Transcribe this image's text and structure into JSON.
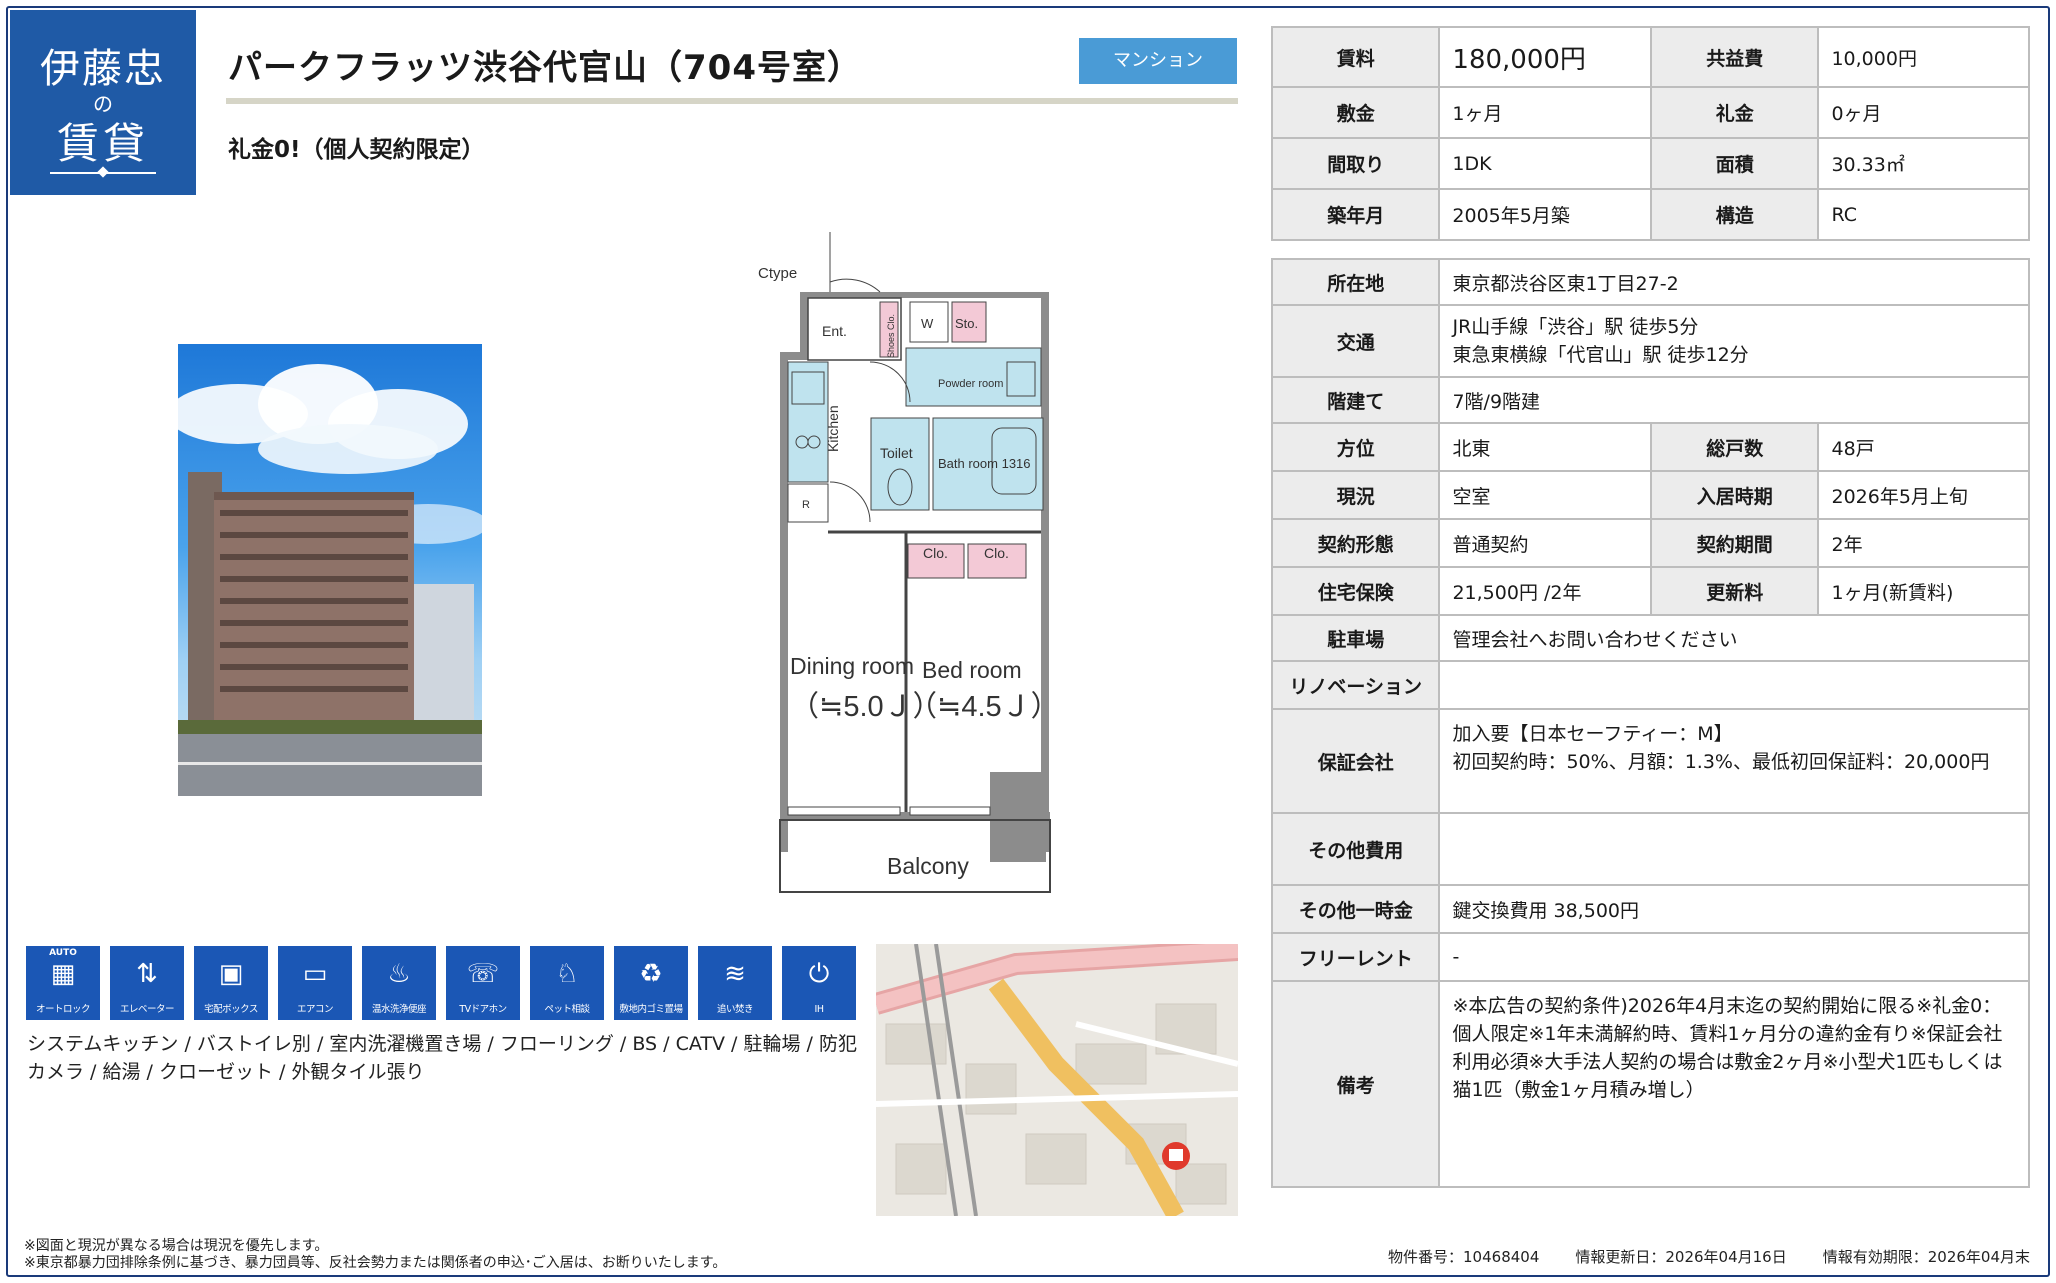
{
  "logo": {
    "line1": "伊藤忠",
    "line2": "の",
    "line3": "賃貸"
  },
  "title": "パークフラッツ渋谷代官山（704号室）",
  "badge": "マンション",
  "subtitle": "礼金0!（個人契約限定）",
  "floorplan": {
    "ctype": "Ctype",
    "ent": "Ent.",
    "shoes": "Shoes Clo.",
    "w": "W",
    "sto": "Sto.",
    "powder": "Powder room",
    "kitchen": "Kitchen",
    "toilet": "Toilet",
    "bath": "Bath room 1316",
    "r": "R",
    "clo1": "Clo.",
    "clo2": "Clo.",
    "dining": "Dining room",
    "dining_size": "（≒5.0Ｊ）",
    "bed": "Bed  room",
    "bed_size": "（≒4.5Ｊ）",
    "balcony": "Balcony"
  },
  "icons": [
    {
      "name": "auto-lock-icon",
      "top": "AUTO",
      "sym": "▦",
      "label": "オートロック"
    },
    {
      "name": "elevator-icon",
      "top": "",
      "sym": "⇅",
      "label": "エレベーター"
    },
    {
      "name": "delivery-box-icon",
      "top": "",
      "sym": "▣",
      "label": "宅配ボックス"
    },
    {
      "name": "air-conditioner-icon",
      "top": "",
      "sym": "▭",
      "label": "エアコン"
    },
    {
      "name": "washlet-icon",
      "top": "",
      "sym": "♨",
      "label": "温水洗浄便座"
    },
    {
      "name": "tv-intercom-icon",
      "top": "",
      "sym": "☏",
      "label": "TVドアホン"
    },
    {
      "name": "pet-icon",
      "top": "",
      "sym": "♘",
      "label": "ペット相談"
    },
    {
      "name": "garbage-icon",
      "top": "",
      "sym": "♻",
      "label": "敷地内ゴミ置場"
    },
    {
      "name": "reheat-bath-icon",
      "top": "",
      "sym": "≋",
      "label": "追い焚き"
    },
    {
      "name": "ih-icon",
      "top": "",
      "sym": "⏻",
      "label": "IH"
    }
  ],
  "equipment": "システムキッチン / バストイレ別 / 室内洗濯機置き場 / フローリング / BS / CATV / 駐輪場 / 防犯カメラ / 給湯 / クローゼット / 外観タイル張り",
  "notes": [
    "※図面と現況が異なる場合は現況を優先します。",
    "※東京都暴力団排除条例に基づき、暴力団員等、反社会勢力または関係者の申込･ご入居は、お断りいたします。"
  ],
  "meta": {
    "id": "物件番号：10468404",
    "updated": "情報更新日：2026年04月16日",
    "valid": "情報有効期限：2026年04月末"
  },
  "table1": [
    {
      "h1": "賃料",
      "v1": "180,000円",
      "h2": "共益費",
      "v2": "10,000円"
    },
    {
      "h1": "敷金",
      "v1": "1ヶ月",
      "h2": "礼金",
      "v2": "0ヶ月"
    },
    {
      "h1": "間取り",
      "v1": "1DK",
      "h2": "面積",
      "v2": "30.33㎡"
    },
    {
      "h1": "築年月",
      "v1": "2005年5月築",
      "h2": "構造",
      "v2": "RC"
    }
  ],
  "table2": {
    "address_h": "所在地",
    "address": "東京都渋谷区東1丁目27-2",
    "transit_h": "交通",
    "transit1": "JR山手線「渋谷」駅 徒歩5分",
    "transit2": "東急東横線「代官山」駅 徒歩12分",
    "floor_h": "階建て",
    "floor": "7階/9階建",
    "dir_h": "方位",
    "dir": "北東",
    "units_h": "総戸数",
    "units": "48戸",
    "status_h": "現況",
    "status": "空室",
    "movein_h": "入居時期",
    "movein": "2026年5月上旬",
    "contract_h": "契約形態",
    "contract": "普通契約",
    "term_h": "契約期間",
    "term": "2年",
    "insurance_h": "住宅保険",
    "insurance": "21,500円 /2年",
    "renewal_h": "更新料",
    "renewal": "1ヶ月(新賃料)",
    "parking_h": "駐車場",
    "parking": "管理会社へお問い合わせください",
    "renovation_h": "リノベーション",
    "renovation": "",
    "guarantor_h": "保証会社",
    "guarantor1": "加入要【日本セーフティー：M】",
    "guarantor2": "初回契約時：50%、月額：1.3%、最低初回保証料：20,000円",
    "other_h": "その他費用",
    "other": "",
    "onetime_h": "その他一時金",
    "onetime": "鍵交換費用 38,500円",
    "freerent_h": "フリーレント",
    "freerent": "-",
    "remarks_h": "備考",
    "remarks": "※本広告の契約条件)2026年4月末迄の契約開始に限る※礼金0：個人限定※1年未満解約時、賃料1ヶ月分の違約金有り※保証会社利用必須※大手法人契約の場合は敷金2ヶ月※小型犬1匹もしくは猫1匹（敷金1ヶ月積み増し）"
  }
}
